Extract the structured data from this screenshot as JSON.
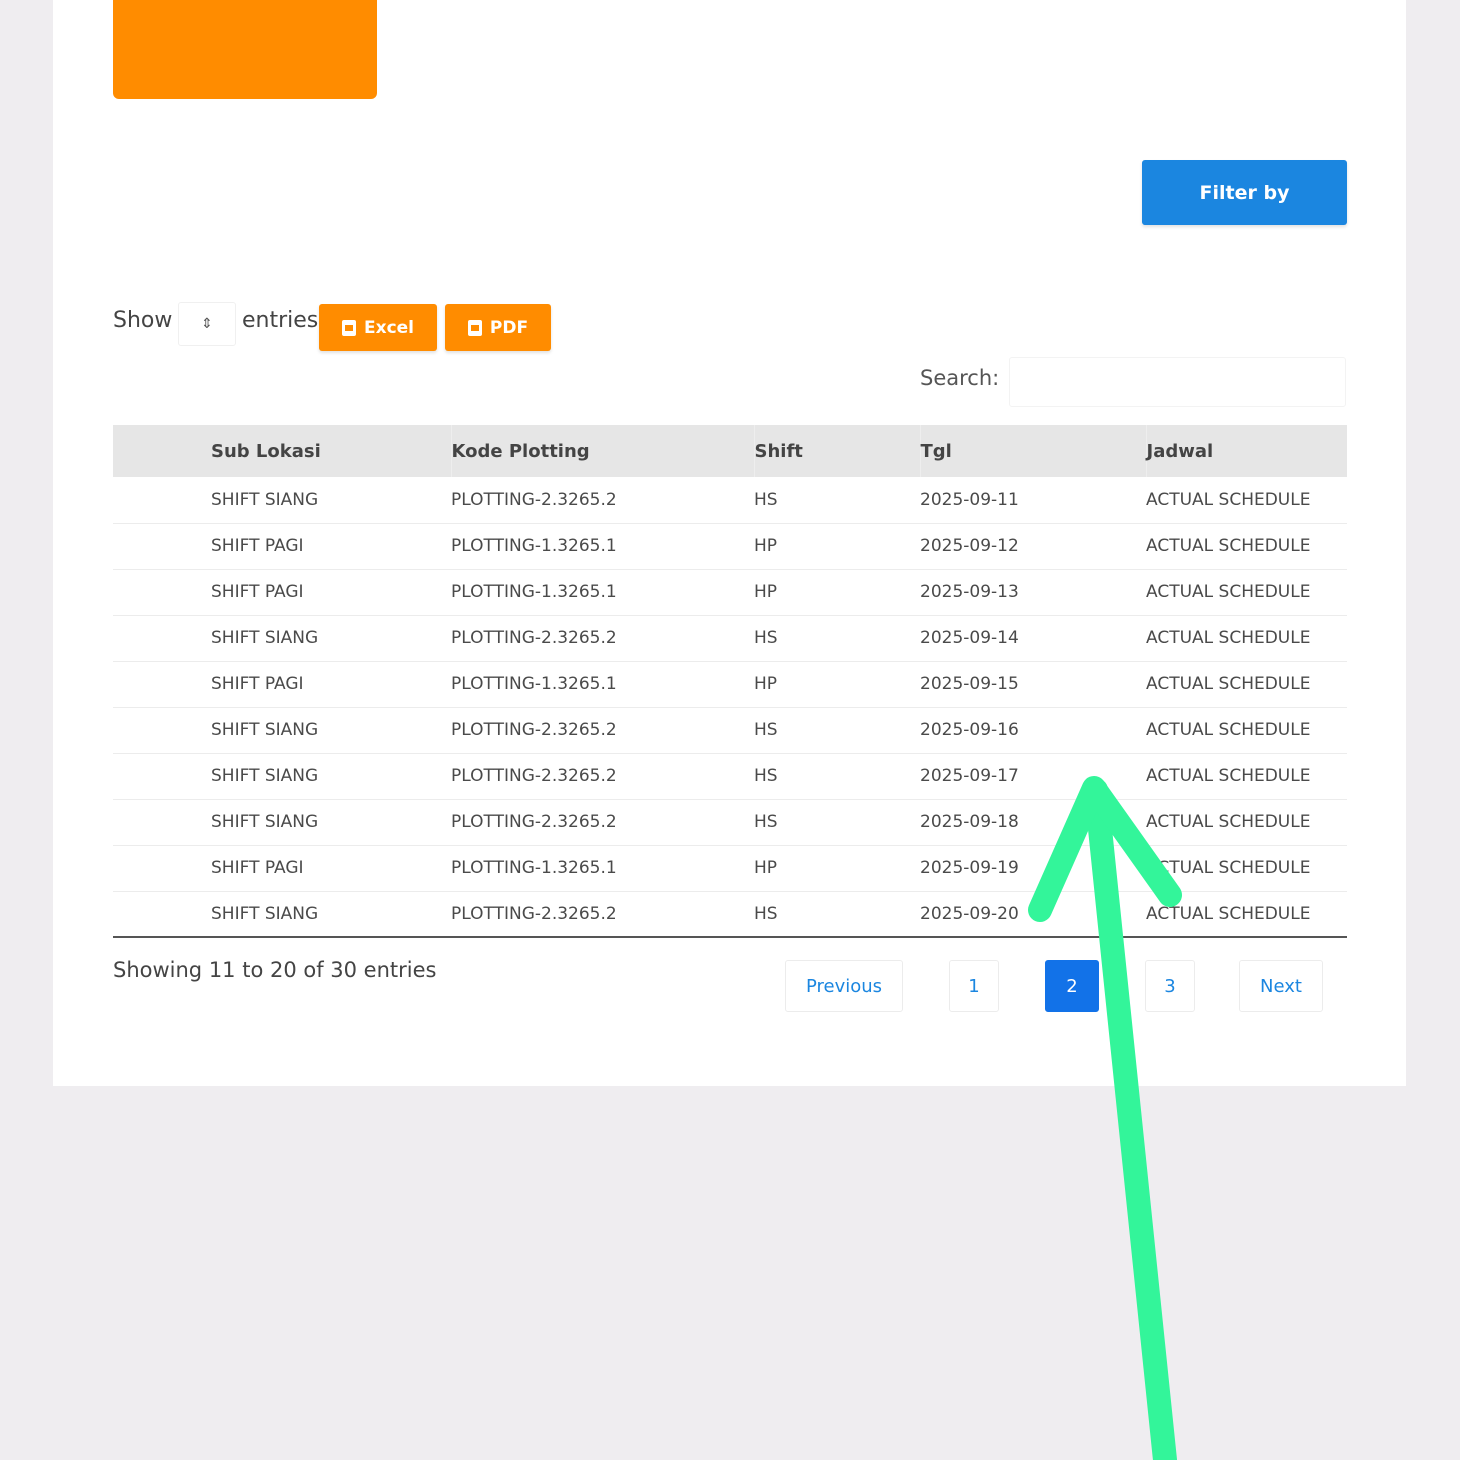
{
  "toolbar": {
    "filter_label": "Filter by",
    "show_label": "Show",
    "entries_label": "entries",
    "length_value": "",
    "excel_label": "Excel",
    "pdf_label": "PDF",
    "search_label": "Search:",
    "search_value": ""
  },
  "table": {
    "headers": [
      "Sub Lokasi",
      "Kode Plotting",
      "Shift",
      "Tgl",
      "Jadwal"
    ],
    "rows": [
      [
        "SHIFT SIANG",
        "PLOTTING-2.3265.2",
        "HS",
        "2025-09-11",
        "ACTUAL SCHEDULE"
      ],
      [
        "SHIFT PAGI",
        "PLOTTING-1.3265.1",
        "HP",
        "2025-09-12",
        "ACTUAL SCHEDULE"
      ],
      [
        "SHIFT PAGI",
        "PLOTTING-1.3265.1",
        "HP",
        "2025-09-13",
        "ACTUAL SCHEDULE"
      ],
      [
        "SHIFT SIANG",
        "PLOTTING-2.3265.2",
        "HS",
        "2025-09-14",
        "ACTUAL SCHEDULE"
      ],
      [
        "SHIFT PAGI",
        "PLOTTING-1.3265.1",
        "HP",
        "2025-09-15",
        "ACTUAL SCHEDULE"
      ],
      [
        "SHIFT SIANG",
        "PLOTTING-2.3265.2",
        "HS",
        "2025-09-16",
        "ACTUAL SCHEDULE"
      ],
      [
        "SHIFT SIANG",
        "PLOTTING-2.3265.2",
        "HS",
        "2025-09-17",
        "ACTUAL SCHEDULE"
      ],
      [
        "SHIFT SIANG",
        "PLOTTING-2.3265.2",
        "HS",
        "2025-09-18",
        "ACTUAL SCHEDULE"
      ],
      [
        "SHIFT PAGI",
        "PLOTTING-1.3265.1",
        "HP",
        "2025-09-19",
        "ACTUAL SCHEDULE"
      ],
      [
        "SHIFT SIANG",
        "PLOTTING-2.3265.2",
        "HS",
        "2025-09-20",
        "ACTUAL SCHEDULE"
      ]
    ]
  },
  "footer": {
    "info": "Showing 11 to 20 of 30 entries",
    "previous_label": "Previous",
    "pages": [
      "1",
      "2",
      "3"
    ],
    "active_page": "2",
    "next_label": "Next"
  },
  "colors": {
    "accent_orange": "#ff8c00",
    "primary_blue": "#1b86e0",
    "active_page_blue": "#1272e8",
    "annotation_arrow": "#33f59a"
  },
  "icons": {
    "export_icon": "file-icon",
    "length_icon": "sort-arrows-icon",
    "annotation": "arrow-up-icon"
  }
}
